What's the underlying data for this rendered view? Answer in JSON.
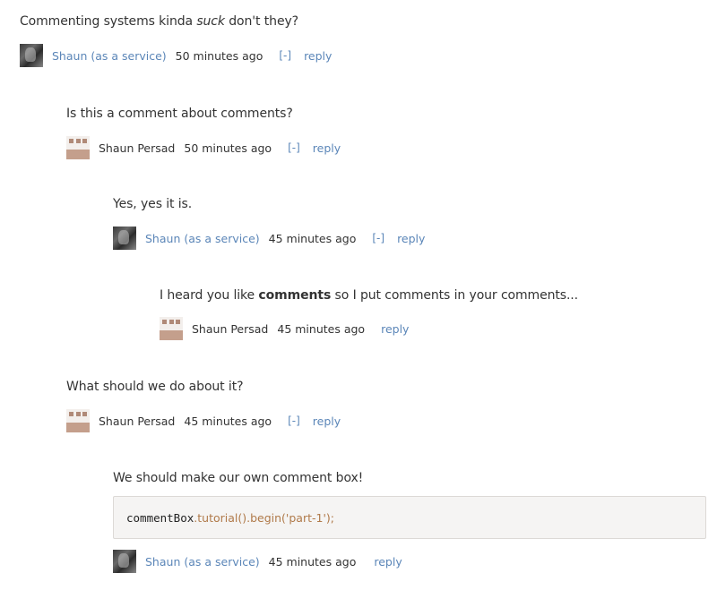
{
  "comments": [
    {
      "text_before": "Commenting systems kinda ",
      "text_em": "suck",
      "text_after": " don't they?",
      "author": "Shaun (as a service)",
      "author_linked": true,
      "time": "50 minutes ago",
      "toggle": "[-]",
      "reply": "reply"
    },
    {
      "text": "Is this a comment about comments?",
      "author": "Shaun Persad",
      "author_linked": false,
      "time": "50 minutes ago",
      "toggle": "[-]",
      "reply": "reply"
    },
    {
      "text": "Yes, yes it is.",
      "author": "Shaun (as a service)",
      "author_linked": true,
      "time": "45 minutes ago",
      "toggle": "[-]",
      "reply": "reply"
    },
    {
      "text_before": "I heard you like ",
      "text_strong": "comments",
      "text_after": " so I put comments in your comments...",
      "author": "Shaun Persad",
      "author_linked": false,
      "time": "45 minutes ago",
      "reply": "reply"
    },
    {
      "text": "What should we do about it?",
      "author": "Shaun Persad",
      "author_linked": false,
      "time": "45 minutes ago",
      "toggle": "[-]",
      "reply": "reply"
    },
    {
      "text": "We should make our own comment box!",
      "code_object": "commentBox",
      "code_rest": ".tutorial().begin('part-1');",
      "author": "Shaun (as a service)",
      "author_linked": true,
      "time": "45 minutes ago",
      "reply": "reply"
    }
  ],
  "colors": {
    "link": "#5b86b8",
    "text": "#333333",
    "code_background": "#f5f4f3",
    "code_method": "#b07a4a"
  },
  "icons": {
    "avatar_photo": "avatar-photo-icon",
    "avatar_identicon": "identicon-avatar-icon"
  }
}
